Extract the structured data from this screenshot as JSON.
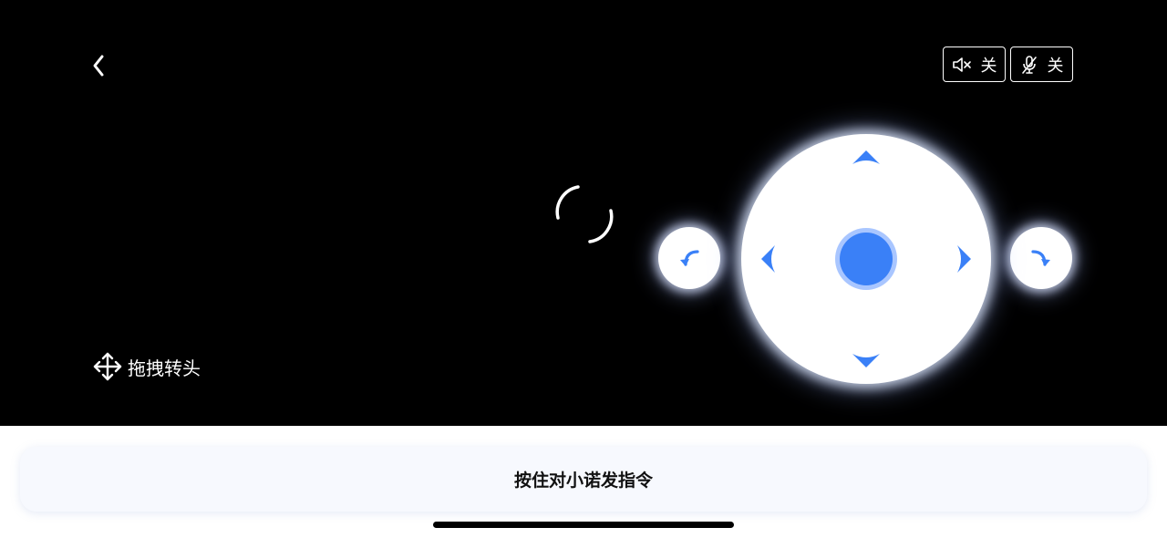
{
  "header": {
    "back_icon": "chevron-left-icon"
  },
  "toggles": {
    "speaker": {
      "icon": "speaker-muted-icon",
      "label": "关"
    },
    "mic": {
      "icon": "mic-muted-icon",
      "label": "关"
    }
  },
  "video": {
    "loading_icon": "loading-spinner-icon",
    "drag_hint": {
      "icon": "move-arrows-icon",
      "label": "拖拽转头"
    }
  },
  "controls": {
    "rotate_left_icon": "rotate-left-icon",
    "rotate_right_icon": "rotate-right-icon",
    "up_icon": "arrow-up-icon",
    "down_icon": "arrow-down-icon",
    "left_icon": "arrow-left-icon",
    "right_icon": "arrow-right-icon",
    "accent_color": "#3a80f7"
  },
  "talk_button": {
    "label": "按住对小诺发指令"
  }
}
